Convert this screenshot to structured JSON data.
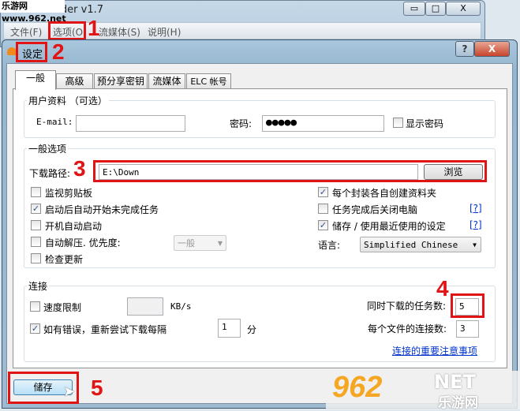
{
  "watermark_top": "乐游网 www.962.net",
  "main_window": {
    "title": "oader v1.7",
    "menu": [
      "文件(F)",
      "选项(O)",
      "流媒体(S)",
      "说明(H)"
    ],
    "minimize": "▭",
    "maximize": "□",
    "close": "X"
  },
  "dialog": {
    "title": "设定",
    "help": "?",
    "close": "X",
    "tabs": [
      "一般",
      "高级",
      "预分享密钥",
      "流媒体",
      "ELC 帐号"
    ],
    "user": {
      "group": "用户资料 （可选）",
      "email_label": "E-mail:",
      "email_value": "",
      "password_label": "密码:",
      "password_value": "●●●●●",
      "show_password": "显示密码",
      "show_password_checked": false
    },
    "general": {
      "group": "一般选项",
      "path_label": "下载路径:",
      "path_value": "E:\\Down",
      "browse": "浏览",
      "left_options": [
        {
          "label": "监视剪贴板",
          "checked": false
        },
        {
          "label": "启动后自动开始未完成任务",
          "checked": true
        },
        {
          "label": "开机自动启动",
          "checked": false
        },
        {
          "label": "自动解压. 优先度:",
          "checked": false
        },
        {
          "label": "检查更新",
          "checked": false
        }
      ],
      "priority_value": "一般",
      "right_options": [
        {
          "label": "每个封装各自创建资料夹",
          "checked": true
        },
        {
          "label": "任务完成后关闭电脑",
          "checked": false,
          "help": "[?]"
        },
        {
          "label": "储存 / 使用最近使用的设定",
          "checked": true,
          "help": "[?]"
        }
      ],
      "language_label": "语言:",
      "language_value": "Simplified Chinese"
    },
    "connection": {
      "group": "连接",
      "speed_limit": "速度限制",
      "speed_limit_checked": false,
      "speed_value": "",
      "speed_unit": "KB/s",
      "retry": "如有错误，重新尝试下载每隔",
      "retry_checked": true,
      "retry_value": "1",
      "retry_unit": "分",
      "concurrent_label": "同时下载的任务数:",
      "concurrent_value": "5",
      "conn_label": "每个文件的连接数:",
      "conn_value": "3",
      "notes_link": "连接的重要注意事项"
    },
    "save": "储存"
  },
  "annotations": [
    "1",
    "2",
    "3",
    "4",
    "5"
  ],
  "watermark": {
    "big": "962",
    "net": "NET",
    "cn": "乐游网"
  },
  "colors": {
    "annotation": "#e01414",
    "link": "#0033cc"
  }
}
